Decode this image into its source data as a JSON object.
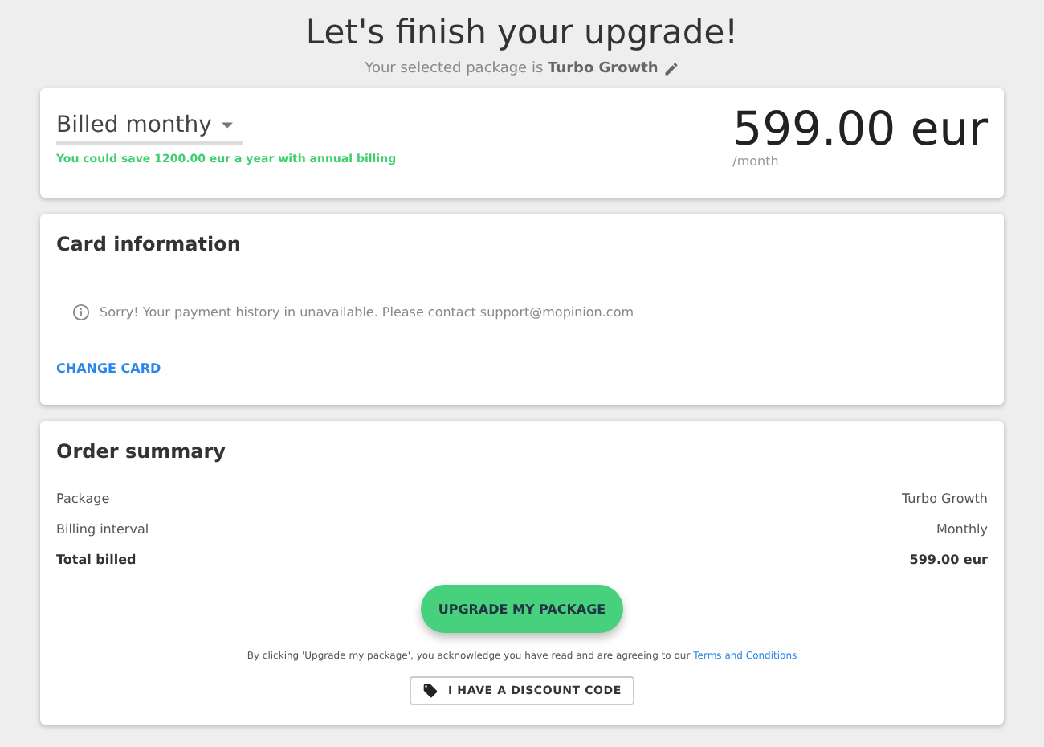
{
  "header": {
    "title": "Let's finish your upgrade!",
    "subtitle": "Your selected package is **Turbo Growth**"
  },
  "billing": {
    "interval": "Billed monthy",
    "savings": "You could save 1200.00 eur a year with annual billing",
    "price": "599.00 eur",
    "period": "/month"
  },
  "card_information": {
    "title": "Card information",
    "notice": "Sorry! Your payment history in unavailable. Please contact support@mopinion.com",
    "action": "CHANGE CARD"
  },
  "order_summary": {
    "title": "Order summary",
    "rows": [
      {
        "label": "Package",
        "value": "Turbo Growth",
        "kind": "normal"
      },
      {
        "label": "Billing interval",
        "value": "Monthly",
        "kind": "normal"
      },
      {
        "label": "Total billed",
        "value": "599.00 eur",
        "kind": "total"
      }
    ],
    "button": "UPGRADE MY PACKAGE",
    "terms": "By clicking 'Upgrade my package', you acknowledge you have read and are agreeing to our",
    "terms_link": "Terms and Conditions",
    "discount": "I HAVE A DISCOUNT CODE"
  }
}
